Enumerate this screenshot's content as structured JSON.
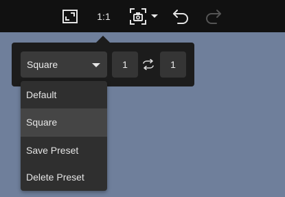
{
  "toolbar": {
    "ratio_label": "1:1",
    "items": [
      {
        "icon": "aspect-ratio-icon"
      },
      {
        "icon": "screenshot-icon"
      },
      {
        "icon": "undo-icon"
      },
      {
        "icon": "redo-icon",
        "state": "disabled"
      }
    ]
  },
  "crop_popover": {
    "preset_select": {
      "selected": "Square"
    },
    "width_value": "1",
    "height_value": "1",
    "swap_icon": "swap-icon"
  },
  "preset_menu": {
    "items": [
      {
        "label": "Default"
      },
      {
        "label": "Square",
        "selected": true
      },
      {
        "label": "Save Preset"
      },
      {
        "label": "Delete Preset"
      }
    ]
  },
  "colors": {
    "canvas": "#6f7f9b",
    "toolbar": "#111111",
    "popover": "#1c1c1c",
    "menu": "#2f2f2f",
    "menu_selected": "#454545"
  }
}
